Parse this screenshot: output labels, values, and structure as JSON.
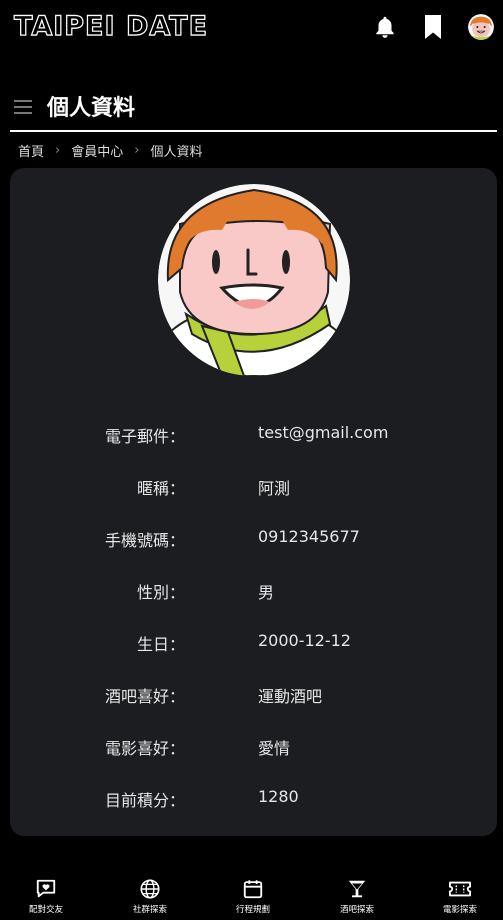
{
  "app": {
    "logo": "TAIPEI DATE"
  },
  "header": {
    "icons": [
      "bell-icon",
      "bookmark-icon",
      "user-avatar"
    ]
  },
  "page": {
    "title": "個人資料",
    "menu_icon": "hamburger-icon"
  },
  "breadcrumb": {
    "items": [
      "首頁",
      "會員中心",
      "個人資料"
    ],
    "separator": ">"
  },
  "profile": {
    "fields": [
      {
        "label": "電子郵件：",
        "value": "test@gmail.com"
      },
      {
        "label": "暱稱：",
        "value": "阿測"
      },
      {
        "label": "手機號碼：",
        "value": "0912345677"
      },
      {
        "label": "性別：",
        "value": "男"
      },
      {
        "label": "生日：",
        "value": "2000-12-12"
      },
      {
        "label": "酒吧喜好：",
        "value": "運動酒吧"
      },
      {
        "label": "電影喜好：",
        "value": "愛情"
      },
      {
        "label": "目前積分：",
        "value": "1280"
      }
    ]
  },
  "bottom_nav": {
    "items": [
      {
        "label": "配對交友",
        "icon": "heart-chat-icon"
      },
      {
        "label": "社群探索",
        "icon": "globe-icon"
      },
      {
        "label": "行程規劃",
        "icon": "calendar-icon"
      },
      {
        "label": "酒吧探索",
        "icon": "cocktail-icon"
      },
      {
        "label": "電影探索",
        "icon": "ticket-icon"
      }
    ]
  },
  "colors": {
    "background": "#000000",
    "card": "#1b1d21",
    "text": "#e6e6e6",
    "hair": "#e07a2c",
    "scarf": "#b6d13a"
  }
}
